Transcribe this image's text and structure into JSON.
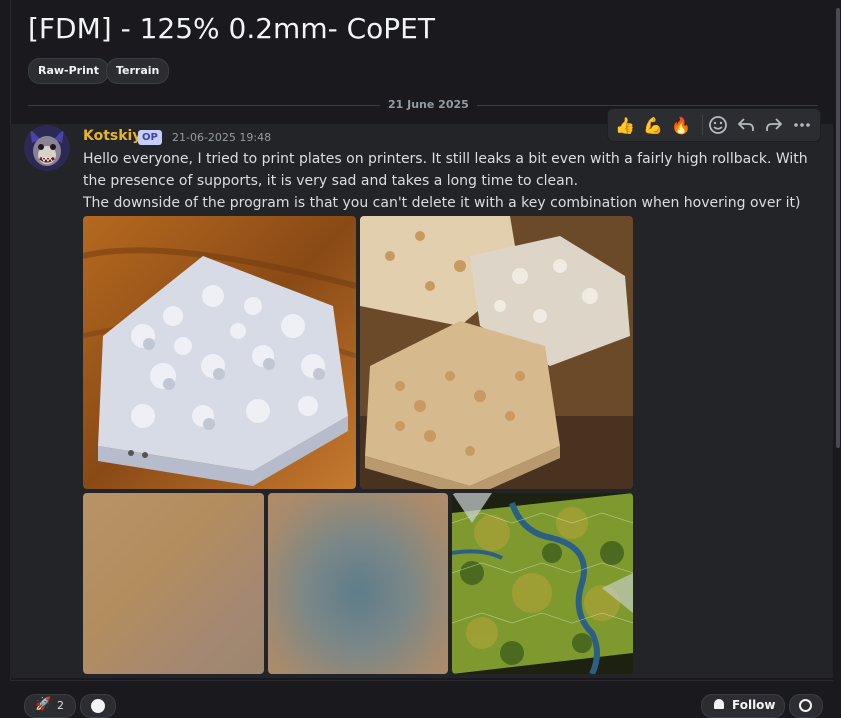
{
  "post": {
    "title": "[FDM] - 125% 0.2mm- CoPET",
    "tags": [
      "Raw-Print",
      "Terrain"
    ]
  },
  "divider": {
    "date": "21 June 2025"
  },
  "message": {
    "author": "Kotskiy",
    "badge": "OP",
    "timestamp": "21-06-2025 19:48",
    "lines": [
      "Hello everyone, I tried to print plates on printers. It still leaks a bit even with a fairly high rollback. With the presence of supports, it is very sad and takes a long time to clean.",
      "The downside of the program is that you can't delete it with a key combination when hovering over it)"
    ]
  },
  "toolbar": {
    "reactions": [
      "👍",
      "💪",
      "🔥"
    ],
    "icons": [
      "add-reaction-icon",
      "reply-icon",
      "forward-icon",
      "more-icon"
    ]
  },
  "footer": {
    "reaction_count": "2",
    "follow_label": "Follow"
  },
  "colors": {
    "author": "#e6b52c",
    "badge_bg": "#c9cdfb",
    "background": "#1a1a1e",
    "message_bg": "#232428"
  }
}
